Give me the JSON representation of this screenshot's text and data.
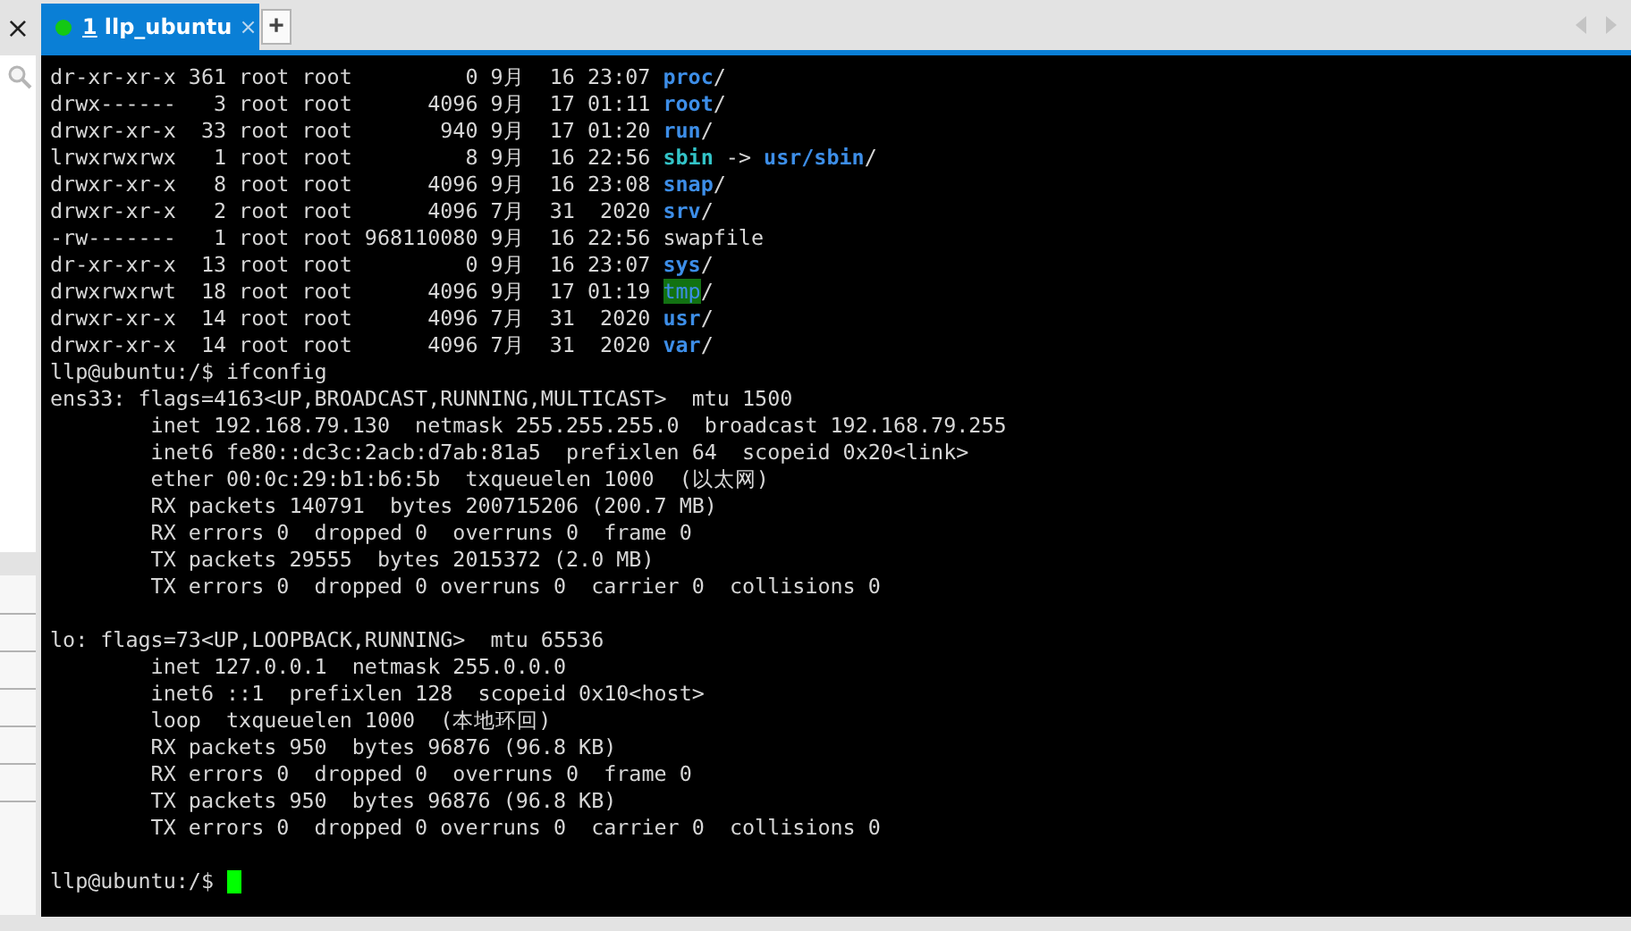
{
  "sidebar": {
    "close_label": "×"
  },
  "tabs": [
    {
      "number": "1",
      "title": "llp_ubuntu",
      "close_label": "×",
      "connected": true,
      "selected": true
    }
  ],
  "new_tab_label": "+",
  "terminal": {
    "cursor": true,
    "blocks": [
      [
        {
          "segments": [
            {
              "text": "dr-xr-xr-x 361 root root         0 9月  16 23:07 ",
              "kind": "plain"
            },
            {
              "text": "proc",
              "kind": "dir"
            },
            {
              "text": "/",
              "kind": "plain"
            }
          ]
        },
        {
          "segments": [
            {
              "text": "drwx------   3 root root      4096 9月  17 01:11 ",
              "kind": "plain"
            },
            {
              "text": "root",
              "kind": "dir"
            },
            {
              "text": "/",
              "kind": "plain"
            }
          ]
        },
        {
          "segments": [
            {
              "text": "drwxr-xr-x  33 root root       940 9月  17 01:20 ",
              "kind": "plain"
            },
            {
              "text": "run",
              "kind": "dir"
            },
            {
              "text": "/",
              "kind": "plain"
            }
          ]
        },
        {
          "segments": [
            {
              "text": "lrwxrwxrwx   1 root root         8 9月  16 22:56 ",
              "kind": "plain"
            },
            {
              "text": "sbin",
              "kind": "link"
            },
            {
              "text": " -> ",
              "kind": "plain"
            },
            {
              "text": "usr/sbin",
              "kind": "dir"
            },
            {
              "text": "/",
              "kind": "plain"
            }
          ]
        },
        {
          "segments": [
            {
              "text": "drwxr-xr-x   8 root root      4096 9月  16 23:08 ",
              "kind": "plain"
            },
            {
              "text": "snap",
              "kind": "dir"
            },
            {
              "text": "/",
              "kind": "plain"
            }
          ]
        },
        {
          "segments": [
            {
              "text": "drwxr-xr-x   2 root root      4096 7月  31  2020 ",
              "kind": "plain"
            },
            {
              "text": "srv",
              "kind": "dir"
            },
            {
              "text": "/",
              "kind": "plain"
            }
          ]
        },
        {
          "segments": [
            {
              "text": "-rw-------   1 root root 968110080 9月  16 22:56 swapfile",
              "kind": "plain"
            }
          ]
        },
        {
          "segments": [
            {
              "text": "dr-xr-xr-x  13 root root         0 9月  16 23:07 ",
              "kind": "plain"
            },
            {
              "text": "sys",
              "kind": "dir"
            },
            {
              "text": "/",
              "kind": "plain"
            }
          ]
        },
        {
          "segments": [
            {
              "text": "drwxrwxrwt  18 root root      4096 9月  17 01:19 ",
              "kind": "plain"
            },
            {
              "text": "tmp",
              "kind": "sticky"
            },
            {
              "text": "/",
              "kind": "plain"
            }
          ]
        },
        {
          "segments": [
            {
              "text": "drwxr-xr-x  14 root root      4096 7月  31  2020 ",
              "kind": "plain"
            },
            {
              "text": "usr",
              "kind": "dir"
            },
            {
              "text": "/",
              "kind": "plain"
            }
          ]
        },
        {
          "segments": [
            {
              "text": "drwxr-xr-x  14 root root      4096 7月  31  2020 ",
              "kind": "plain"
            },
            {
              "text": "var",
              "kind": "dir"
            },
            {
              "text": "/",
              "kind": "plain"
            }
          ]
        },
        {
          "segments": [
            {
              "text": "llp@ubuntu:/$ ifconfig",
              "kind": "plain"
            }
          ]
        },
        {
          "segments": [
            {
              "text": "ens33: flags=4163<UP,BROADCAST,RUNNING,MULTICAST>  mtu 1500",
              "kind": "plain"
            }
          ]
        },
        {
          "segments": [
            {
              "text": "        inet 192.168.79.130  netmask 255.255.255.0  broadcast 192.168.79.255",
              "kind": "plain"
            }
          ]
        },
        {
          "segments": [
            {
              "text": "        inet6 fe80::dc3c:2acb:d7ab:81a5  prefixlen 64  scopeid 0x20<link>",
              "kind": "plain"
            }
          ]
        },
        {
          "segments": [
            {
              "text": "        ether 00:0c:29:b1:b6:5b  txqueuelen 1000  (以太网)",
              "kind": "plain"
            }
          ]
        },
        {
          "segments": [
            {
              "text": "        RX packets 140791  bytes 200715206 (200.7 MB)",
              "kind": "plain"
            }
          ]
        },
        {
          "segments": [
            {
              "text": "        RX errors 0  dropped 0  overruns 0  frame 0",
              "kind": "plain"
            }
          ]
        },
        {
          "segments": [
            {
              "text": "        TX packets 29555  bytes 2015372 (2.0 MB)",
              "kind": "plain"
            }
          ]
        },
        {
          "segments": [
            {
              "text": "        TX errors 0  dropped 0 overruns 0  carrier 0  collisions 0",
              "kind": "plain"
            }
          ]
        }
      ],
      [
        {
          "segments": [
            {
              "text": "lo: flags=73<UP,LOOPBACK,RUNNING>  mtu 65536",
              "kind": "plain"
            }
          ]
        },
        {
          "segments": [
            {
              "text": "        inet 127.0.0.1  netmask 255.0.0.0",
              "kind": "plain"
            }
          ]
        },
        {
          "segments": [
            {
              "text": "        inet6 ::1  prefixlen 128  scopeid 0x10<host>",
              "kind": "plain"
            }
          ]
        },
        {
          "segments": [
            {
              "text": "        loop  txqueuelen 1000  (本地环回)",
              "kind": "plain"
            }
          ]
        },
        {
          "segments": [
            {
              "text": "        RX packets 950  bytes 96876 (96.8 KB)",
              "kind": "plain"
            }
          ]
        },
        {
          "segments": [
            {
              "text": "        RX errors 0  dropped 0  overruns 0  frame 0",
              "kind": "plain"
            }
          ]
        },
        {
          "segments": [
            {
              "text": "        TX packets 950  bytes 96876 (96.8 KB)",
              "kind": "plain"
            }
          ]
        },
        {
          "segments": [
            {
              "text": "        TX errors 0  dropped 0 overruns 0  carrier 0  collisions 0",
              "kind": "plain"
            }
          ]
        }
      ],
      [
        {
          "segments": [
            {
              "text": "llp@ubuntu:/$ ",
              "kind": "plain"
            }
          ]
        }
      ]
    ]
  }
}
